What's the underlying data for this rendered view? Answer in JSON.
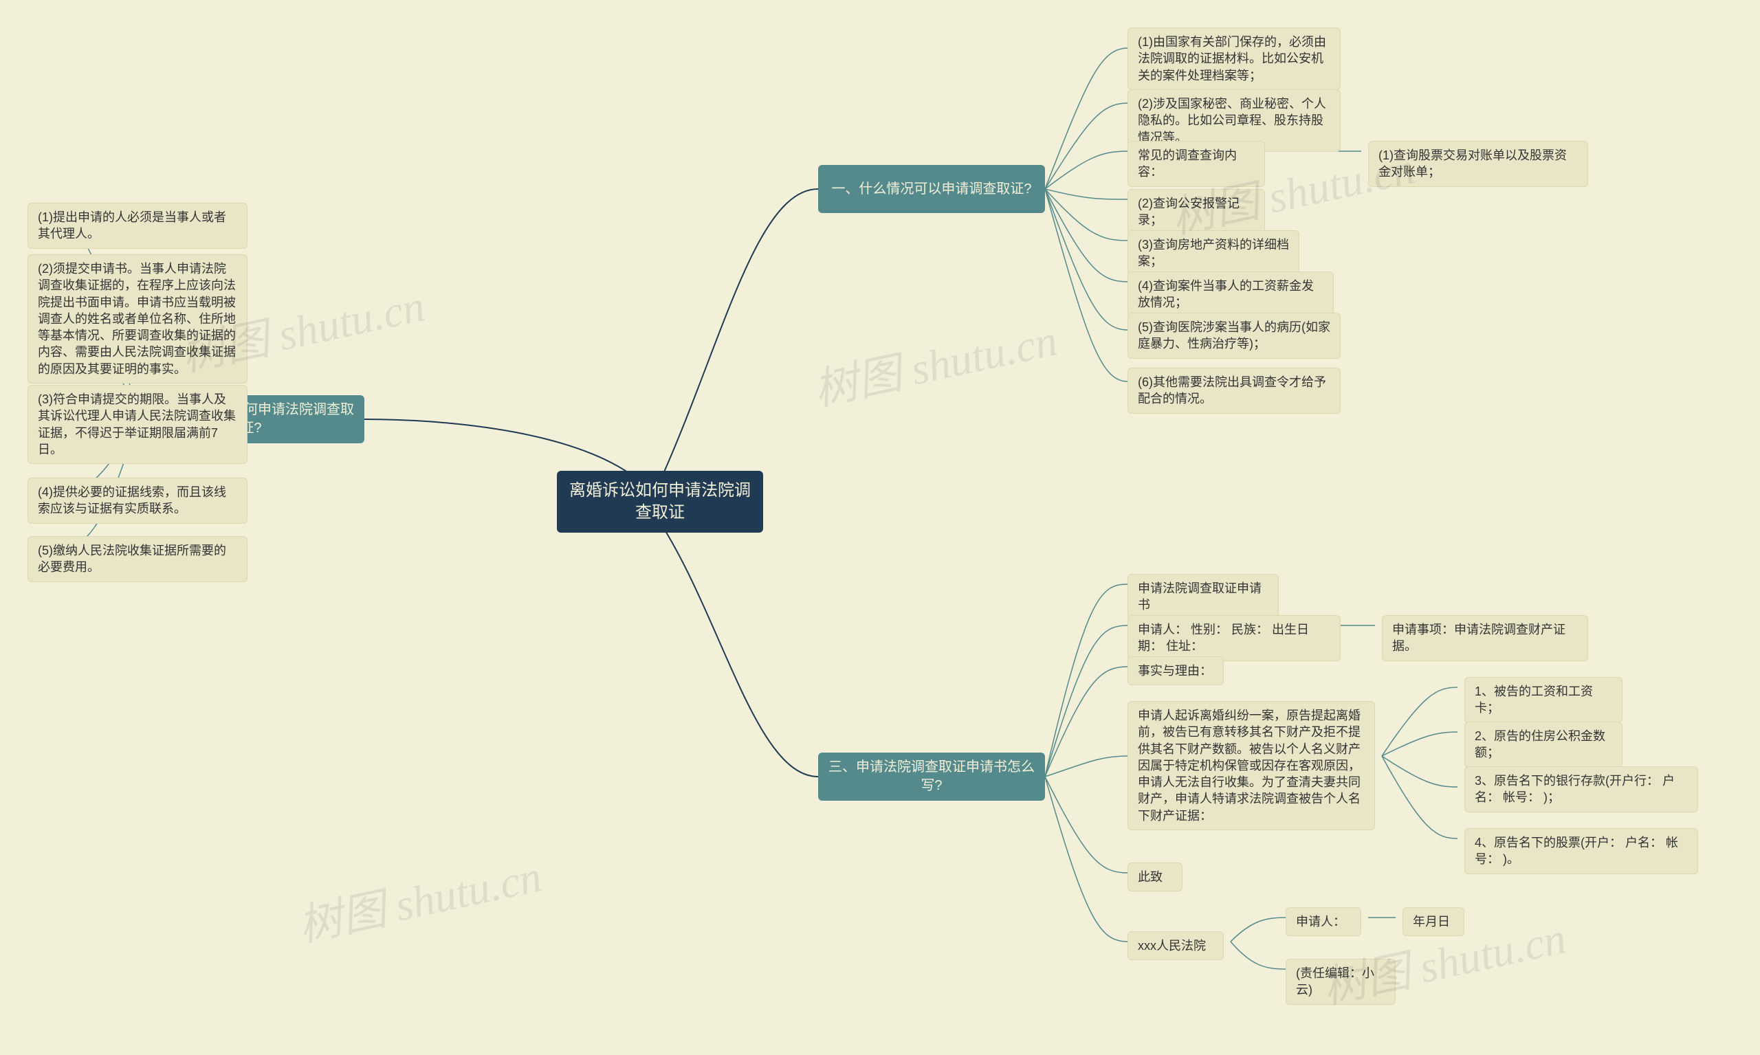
{
  "root": {
    "title": "离婚诉讼如何申请法院调\n查取证"
  },
  "branch1": {
    "title": "一、什么情况可以申请调查取证?"
  },
  "b1": {
    "n1": "(1)由国家有关部门保存的，必须由法院调取的证据材料。比如公安机关的案件处理档案等；",
    "n2": "(2)涉及国家秘密、商业秘密、个人隐私的。比如公司章程、股东持股情况等。",
    "n3": "常见的调查查询内容：",
    "n3s": "(1)查询股票交易对账单以及股票资金对账单；",
    "n4": "(2)查询公安报警记录；",
    "n5": "(3)查询房地产资料的详细档案；",
    "n6": "(4)查询案件当事人的工资薪金发放情况；",
    "n7": "(5)查询医院涉案当事人的病历(如家庭暴力、性病治疗等)；",
    "n8": "(6)其他需要法院出具调查令才给予配合的情况。"
  },
  "branch2": {
    "title": "二、离婚诉讼如何申请法院调查取\n证?"
  },
  "b2": {
    "n1": "(1)提出申请的人必须是当事人或者其代理人。",
    "n2": "(2)须提交申请书。当事人申请法院调查收集证据的，在程序上应该向法院提出书面申请。申请书应当载明被调查人的姓名或者单位名称、住所地等基本情况、所要调查收集的证据的内容、需要由人民法院调查收集证据的原因及其要证明的事实。",
    "n3": "(3)符合申请提交的期限。当事人及其诉讼代理人申请人民法院调查收集证据，不得迟于举证期限届满前7日。",
    "n4": "(4)提供必要的证据线索，而且该线索应该与证据有实质联系。",
    "n5": "(5)缴纳人民法院收集证据所需要的必要费用。"
  },
  "branch3": {
    "title": "三、申请法院调查取证申请书怎么\n写?"
  },
  "b3": {
    "n1": "申请法院调查取证申请书",
    "n2": "申请人：  性别：  民族：  出生日期：  住址：",
    "n2s": "申请事项：申请法院调查财产证据。",
    "n3": "事实与理由：",
    "n4": "申请人起诉离婚纠纷一案，原告提起离婚前，被告已有意转移其名下财产及拒不提供其名下财产数额。被告以个人名义财产因属于特定机构保管或因存在客观原因，申请人无法自行收集。为了查清夫妻共同财产，申请人特请求法院调查被告个人名下财产证据：",
    "n4s1": "1、被告的工资和工资卡；",
    "n4s2": "2、原告的住房公积金数额；",
    "n4s3": "3、原告名下的银行存款(开户行：  户名：  帐号：  )；",
    "n4s4": "4、原告名下的股票(开户：  户名：  帐号：  )。",
    "n5": "此致",
    "n6": "xxx人民法院",
    "n6s1": "申请人：",
    "n6s1s": "年月日",
    "n6s2": "(责任编辑：小云)"
  },
  "watermark": "树图 shutu.cn"
}
